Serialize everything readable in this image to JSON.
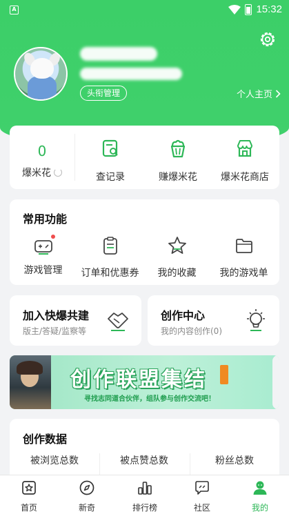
{
  "status_bar": {
    "time": "15:32"
  },
  "profile": {
    "title_management": "头衔管理",
    "homepage_link": "个人主页"
  },
  "popcorn": {
    "count": "0",
    "label": "爆米花",
    "actions": [
      {
        "label": "查记录",
        "icon": "record-search-icon"
      },
      {
        "label": "赚爆米花",
        "icon": "popcorn-bucket-icon"
      },
      {
        "label": "爆米花商店",
        "icon": "store-icon"
      }
    ]
  },
  "common_functions": {
    "title": "常用功能",
    "items": [
      {
        "label": "游戏管理",
        "icon": "gamepad-icon"
      },
      {
        "label": "订单和优惠券",
        "icon": "clipboard-icon"
      },
      {
        "label": "我的收藏",
        "icon": "star-icon"
      },
      {
        "label": "我的游戏单",
        "icon": "folder-icon"
      }
    ]
  },
  "join_card": {
    "title": "加入快爆共建",
    "subtitle": "版主/答疑/监察等"
  },
  "creation_card": {
    "title": "创作中心",
    "subtitle": "我的内容创作(0)"
  },
  "banner": {
    "title": "创作联盟集结",
    "subtitle": "寻找志同道合伙伴，组队参与创作交流吧！"
  },
  "creation_data": {
    "title": "创作数据",
    "columns": [
      "被浏览总数",
      "被点赞总数",
      "粉丝总数"
    ]
  },
  "bottom_nav": [
    {
      "label": "首页",
      "icon": "home-star-icon"
    },
    {
      "label": "新奇",
      "icon": "compass-icon"
    },
    {
      "label": "排行榜",
      "icon": "ranking-icon"
    },
    {
      "label": "社区",
      "icon": "community-icon"
    },
    {
      "label": "我的",
      "icon": "profile-icon"
    }
  ],
  "colors": {
    "brand_green": "#3ccf68",
    "accent_green": "#2db757",
    "background": "#f2f3f5",
    "badge_red": "#ef4d4d"
  }
}
